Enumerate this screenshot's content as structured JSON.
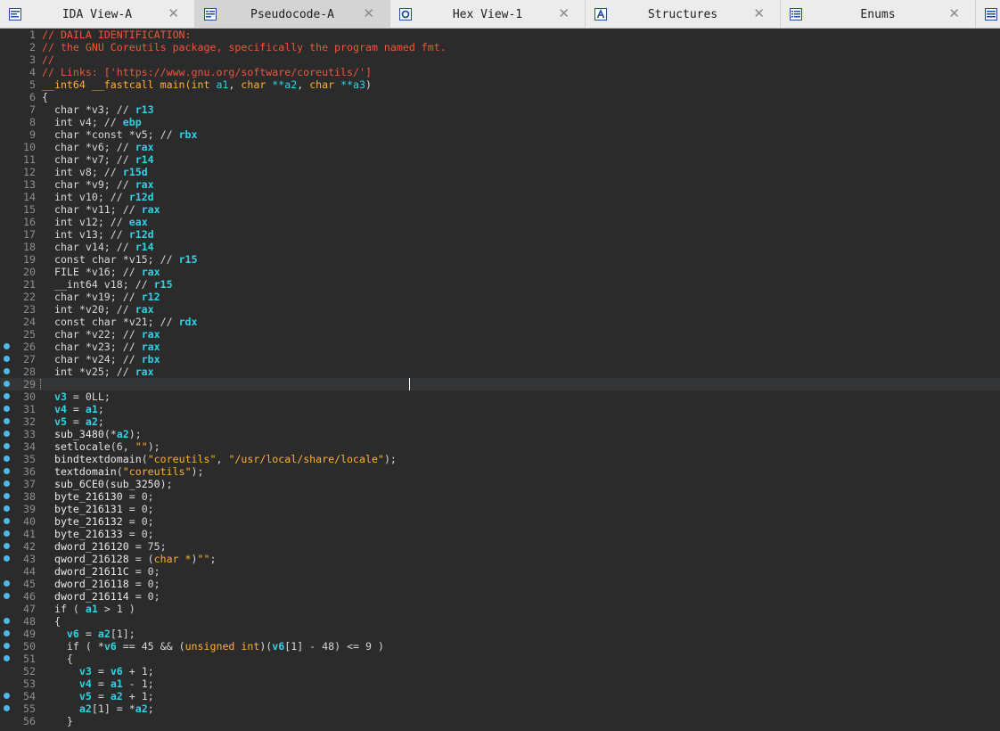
{
  "tabs": [
    {
      "label": "IDA View-A",
      "icon": "ida-view-icon",
      "active": false
    },
    {
      "label": "Pseudocode-A",
      "icon": "pseudocode-icon",
      "active": true
    },
    {
      "label": "Hex View-1",
      "icon": "hex-view-icon",
      "active": false
    },
    {
      "label": "Structures",
      "icon": "structures-icon",
      "active": false
    },
    {
      "label": "Enums",
      "icon": "enums-icon",
      "active": false
    }
  ],
  "close_glyph": "✕",
  "colors": {
    "background": "#2b2b2b",
    "comment": "#f0553b",
    "register": "#2ed3e6",
    "string": "#ffb02e",
    "breakpoint_dot": "#4fb8ea"
  },
  "cursor_line": 29,
  "lines": [
    {
      "n": "1",
      "dot": false,
      "tokens": [
        [
          "// DAILA IDENTIFICATION:",
          "comment"
        ]
      ]
    },
    {
      "n": "2",
      "dot": false,
      "tokens": [
        [
          "// the GNU Coreutils package, specifically the program named fmt.",
          "comment"
        ]
      ]
    },
    {
      "n": "3",
      "dot": false,
      "tokens": [
        [
          "//",
          "comment"
        ]
      ]
    },
    {
      "n": "4",
      "dot": false,
      "tokens": [
        [
          "// Links: ['https://www.gnu.org/software/coreutils/']",
          "comment"
        ]
      ]
    },
    {
      "n": "5",
      "dot": false,
      "tokens": [
        [
          "__int64 __fastcall main(",
          "type"
        ],
        [
          "int ",
          "type"
        ],
        [
          "a1",
          "var"
        ],
        [
          ", ",
          "plain"
        ],
        [
          "char ",
          "type"
        ],
        [
          "**a2",
          "var"
        ],
        [
          ", ",
          "plain"
        ],
        [
          "char ",
          "type"
        ],
        [
          "**a3",
          "var"
        ],
        [
          ")",
          "plain"
        ]
      ]
    },
    {
      "n": "6",
      "dot": false,
      "tokens": [
        [
          "{",
          "plain"
        ]
      ]
    },
    {
      "n": "7",
      "dot": false,
      "tokens": [
        [
          "  char *v3; // ",
          "kw"
        ],
        [
          "r13",
          "reg"
        ]
      ]
    },
    {
      "n": "8",
      "dot": false,
      "tokens": [
        [
          "  int v4; // ",
          "kw"
        ],
        [
          "ebp",
          "reg"
        ]
      ]
    },
    {
      "n": "9",
      "dot": false,
      "tokens": [
        [
          "  char *const *v5; // ",
          "kw"
        ],
        [
          "rbx",
          "reg"
        ]
      ]
    },
    {
      "n": "10",
      "dot": false,
      "tokens": [
        [
          "  char *v6; // ",
          "kw"
        ],
        [
          "rax",
          "reg"
        ]
      ]
    },
    {
      "n": "11",
      "dot": false,
      "tokens": [
        [
          "  char *v7; // ",
          "kw"
        ],
        [
          "r14",
          "reg"
        ]
      ]
    },
    {
      "n": "12",
      "dot": false,
      "tokens": [
        [
          "  int v8; // ",
          "kw"
        ],
        [
          "r15d",
          "reg"
        ]
      ]
    },
    {
      "n": "13",
      "dot": false,
      "tokens": [
        [
          "  char *v9; // ",
          "kw"
        ],
        [
          "rax",
          "reg"
        ]
      ]
    },
    {
      "n": "14",
      "dot": false,
      "tokens": [
        [
          "  int v10; // ",
          "kw"
        ],
        [
          "r12d",
          "reg"
        ]
      ]
    },
    {
      "n": "15",
      "dot": false,
      "tokens": [
        [
          "  char *v11; // ",
          "kw"
        ],
        [
          "rax",
          "reg"
        ]
      ]
    },
    {
      "n": "16",
      "dot": false,
      "tokens": [
        [
          "  int v12; // ",
          "kw"
        ],
        [
          "eax",
          "reg"
        ]
      ]
    },
    {
      "n": "17",
      "dot": false,
      "tokens": [
        [
          "  int v13; // ",
          "kw"
        ],
        [
          "r12d",
          "reg"
        ]
      ]
    },
    {
      "n": "18",
      "dot": false,
      "tokens": [
        [
          "  char v14; // ",
          "kw"
        ],
        [
          "r14",
          "reg"
        ]
      ]
    },
    {
      "n": "19",
      "dot": false,
      "tokens": [
        [
          "  const char *v15; // ",
          "kw"
        ],
        [
          "r15",
          "reg"
        ]
      ]
    },
    {
      "n": "20",
      "dot": false,
      "tokens": [
        [
          "  FILE *v16; // ",
          "kw"
        ],
        [
          "rax",
          "reg"
        ]
      ]
    },
    {
      "n": "21",
      "dot": false,
      "tokens": [
        [
          "  __int64 v18; // ",
          "kw"
        ],
        [
          "r15",
          "reg"
        ]
      ]
    },
    {
      "n": "22",
      "dot": false,
      "tokens": [
        [
          "  char *v19; // ",
          "kw"
        ],
        [
          "r12",
          "reg"
        ]
      ]
    },
    {
      "n": "23",
      "dot": false,
      "tokens": [
        [
          "  int *v20; // ",
          "kw"
        ],
        [
          "rax",
          "reg"
        ]
      ]
    },
    {
      "n": "24",
      "dot": false,
      "tokens": [
        [
          "  const char *v21; // ",
          "kw"
        ],
        [
          "rdx",
          "reg"
        ]
      ]
    },
    {
      "n": "25",
      "dot": false,
      "tokens": [
        [
          "  char *v22; // ",
          "kw"
        ],
        [
          "rax",
          "reg"
        ]
      ]
    },
    {
      "n": "26",
      "dot": true,
      "tokens": [
        [
          "  char *v23; // ",
          "kw"
        ],
        [
          "rax",
          "reg"
        ]
      ]
    },
    {
      "n": "27",
      "dot": true,
      "tokens": [
        [
          "  char *v24; // ",
          "kw"
        ],
        [
          "rbx",
          "reg"
        ]
      ]
    },
    {
      "n": "28",
      "dot": true,
      "tokens": [
        [
          "  int *v25; // ",
          "kw"
        ],
        [
          "rax",
          "reg"
        ]
      ]
    },
    {
      "n": "29",
      "dot": true,
      "tokens": []
    },
    {
      "n": "30",
      "dot": true,
      "tokens": [
        [
          "  ",
          "plain"
        ],
        [
          "v3",
          "reg"
        ],
        [
          " = 0LL;",
          "plain"
        ]
      ]
    },
    {
      "n": "31",
      "dot": true,
      "tokens": [
        [
          "  ",
          "plain"
        ],
        [
          "v4",
          "reg"
        ],
        [
          " = ",
          "plain"
        ],
        [
          "a1",
          "reg"
        ],
        [
          ";",
          "plain"
        ]
      ]
    },
    {
      "n": "32",
      "dot": true,
      "tokens": [
        [
          "  ",
          "plain"
        ],
        [
          "v5",
          "reg"
        ],
        [
          " = ",
          "plain"
        ],
        [
          "a2",
          "reg"
        ],
        [
          ";",
          "plain"
        ]
      ]
    },
    {
      "n": "33",
      "dot": true,
      "tokens": [
        [
          "  ",
          "plain"
        ],
        [
          "sub_3480",
          "call"
        ],
        [
          "(*",
          "plain"
        ],
        [
          "a2",
          "reg"
        ],
        [
          ");",
          "plain"
        ]
      ]
    },
    {
      "n": "34",
      "dot": true,
      "tokens": [
        [
          "  ",
          "plain"
        ],
        [
          "setlocale",
          "call"
        ],
        [
          "(6, ",
          "plain"
        ],
        [
          "\"\"",
          "str"
        ],
        [
          ");",
          "plain"
        ]
      ]
    },
    {
      "n": "35",
      "dot": true,
      "tokens": [
        [
          "  ",
          "plain"
        ],
        [
          "bindtextdomain",
          "call"
        ],
        [
          "(",
          "plain"
        ],
        [
          "\"coreutils\"",
          "str"
        ],
        [
          ", ",
          "plain"
        ],
        [
          "\"/usr/local/share/locale\"",
          "str"
        ],
        [
          ");",
          "plain"
        ]
      ]
    },
    {
      "n": "36",
      "dot": true,
      "tokens": [
        [
          "  ",
          "plain"
        ],
        [
          "textdomain",
          "call"
        ],
        [
          "(",
          "plain"
        ],
        [
          "\"coreutils\"",
          "str"
        ],
        [
          ");",
          "plain"
        ]
      ]
    },
    {
      "n": "37",
      "dot": true,
      "tokens": [
        [
          "  ",
          "plain"
        ],
        [
          "sub_6CE0",
          "call"
        ],
        [
          "(",
          "plain"
        ],
        [
          "sub_3250",
          "call"
        ],
        [
          ");",
          "plain"
        ]
      ]
    },
    {
      "n": "38",
      "dot": true,
      "tokens": [
        [
          "  ",
          "plain"
        ],
        [
          "byte_216130",
          "gvar"
        ],
        [
          " = 0;",
          "plain"
        ]
      ]
    },
    {
      "n": "39",
      "dot": true,
      "tokens": [
        [
          "  ",
          "plain"
        ],
        [
          "byte_216131",
          "gvar"
        ],
        [
          " = 0;",
          "plain"
        ]
      ]
    },
    {
      "n": "40",
      "dot": true,
      "tokens": [
        [
          "  ",
          "plain"
        ],
        [
          "byte_216132",
          "gvar"
        ],
        [
          " = 0;",
          "plain"
        ]
      ]
    },
    {
      "n": "41",
      "dot": true,
      "tokens": [
        [
          "  ",
          "plain"
        ],
        [
          "byte_216133",
          "gvar"
        ],
        [
          " = 0;",
          "plain"
        ]
      ]
    },
    {
      "n": "42",
      "dot": true,
      "tokens": [
        [
          "  ",
          "plain"
        ],
        [
          "dword_216120",
          "gvar"
        ],
        [
          " = 75;",
          "plain"
        ]
      ]
    },
    {
      "n": "43",
      "dot": true,
      "tokens": [
        [
          "  ",
          "plain"
        ],
        [
          "qword_216128",
          "gvar"
        ],
        [
          " = (",
          "plain"
        ],
        [
          "char *",
          "type"
        ],
        [
          ")",
          "plain"
        ],
        [
          "\"\"",
          "str"
        ],
        [
          ";",
          "plain"
        ]
      ]
    },
    {
      "n": "44",
      "dot": false,
      "tokens": [
        [
          "  ",
          "plain"
        ],
        [
          "dword_21611C",
          "gvar"
        ],
        [
          " = 0;",
          "plain"
        ]
      ]
    },
    {
      "n": "45",
      "dot": true,
      "tokens": [
        [
          "  ",
          "plain"
        ],
        [
          "dword_216118",
          "gvar"
        ],
        [
          " = 0;",
          "plain"
        ]
      ]
    },
    {
      "n": "46",
      "dot": true,
      "tokens": [
        [
          "  ",
          "plain"
        ],
        [
          "dword_216114",
          "gvar"
        ],
        [
          " = 0;",
          "plain"
        ]
      ]
    },
    {
      "n": "47",
      "dot": false,
      "tokens": [
        [
          "  if ( ",
          "plain"
        ],
        [
          "a1",
          "reg"
        ],
        [
          " > 1 )",
          "plain"
        ]
      ]
    },
    {
      "n": "48",
      "dot": true,
      "tokens": [
        [
          "  {",
          "plain"
        ]
      ]
    },
    {
      "n": "49",
      "dot": true,
      "tokens": [
        [
          "    ",
          "plain"
        ],
        [
          "v6",
          "reg"
        ],
        [
          " = ",
          "plain"
        ],
        [
          "a2",
          "reg"
        ],
        [
          "[1];",
          "plain"
        ]
      ]
    },
    {
      "n": "50",
      "dot": true,
      "tokens": [
        [
          "    if ( *",
          "plain"
        ],
        [
          "v6",
          "reg"
        ],
        [
          " == 45 && (",
          "plain"
        ],
        [
          "unsigned int",
          "type"
        ],
        [
          ")(",
          "plain"
        ],
        [
          "v6",
          "reg"
        ],
        [
          "[1] - 48) <= 9 )",
          "plain"
        ]
      ]
    },
    {
      "n": "51",
      "dot": true,
      "tokens": [
        [
          "    {",
          "plain"
        ]
      ]
    },
    {
      "n": "52",
      "dot": false,
      "tokens": [
        [
          "      ",
          "plain"
        ],
        [
          "v3",
          "reg"
        ],
        [
          " = ",
          "plain"
        ],
        [
          "v6",
          "reg"
        ],
        [
          " + 1;",
          "plain"
        ]
      ]
    },
    {
      "n": "53",
      "dot": false,
      "tokens": [
        [
          "      ",
          "plain"
        ],
        [
          "v4",
          "reg"
        ],
        [
          " = ",
          "plain"
        ],
        [
          "a1",
          "reg"
        ],
        [
          " - 1;",
          "plain"
        ]
      ]
    },
    {
      "n": "54",
      "dot": true,
      "tokens": [
        [
          "      ",
          "plain"
        ],
        [
          "v5",
          "reg"
        ],
        [
          " = ",
          "plain"
        ],
        [
          "a2",
          "reg"
        ],
        [
          " + 1;",
          "plain"
        ]
      ]
    },
    {
      "n": "55",
      "dot": true,
      "tokens": [
        [
          "      ",
          "plain"
        ],
        [
          "a2",
          "reg"
        ],
        [
          "[1] = *",
          "plain"
        ],
        [
          "a2",
          "reg"
        ],
        [
          ";",
          "plain"
        ]
      ]
    },
    {
      "n": "56",
      "dot": false,
      "tokens": [
        [
          "    }",
          "plain"
        ]
      ]
    }
  ]
}
